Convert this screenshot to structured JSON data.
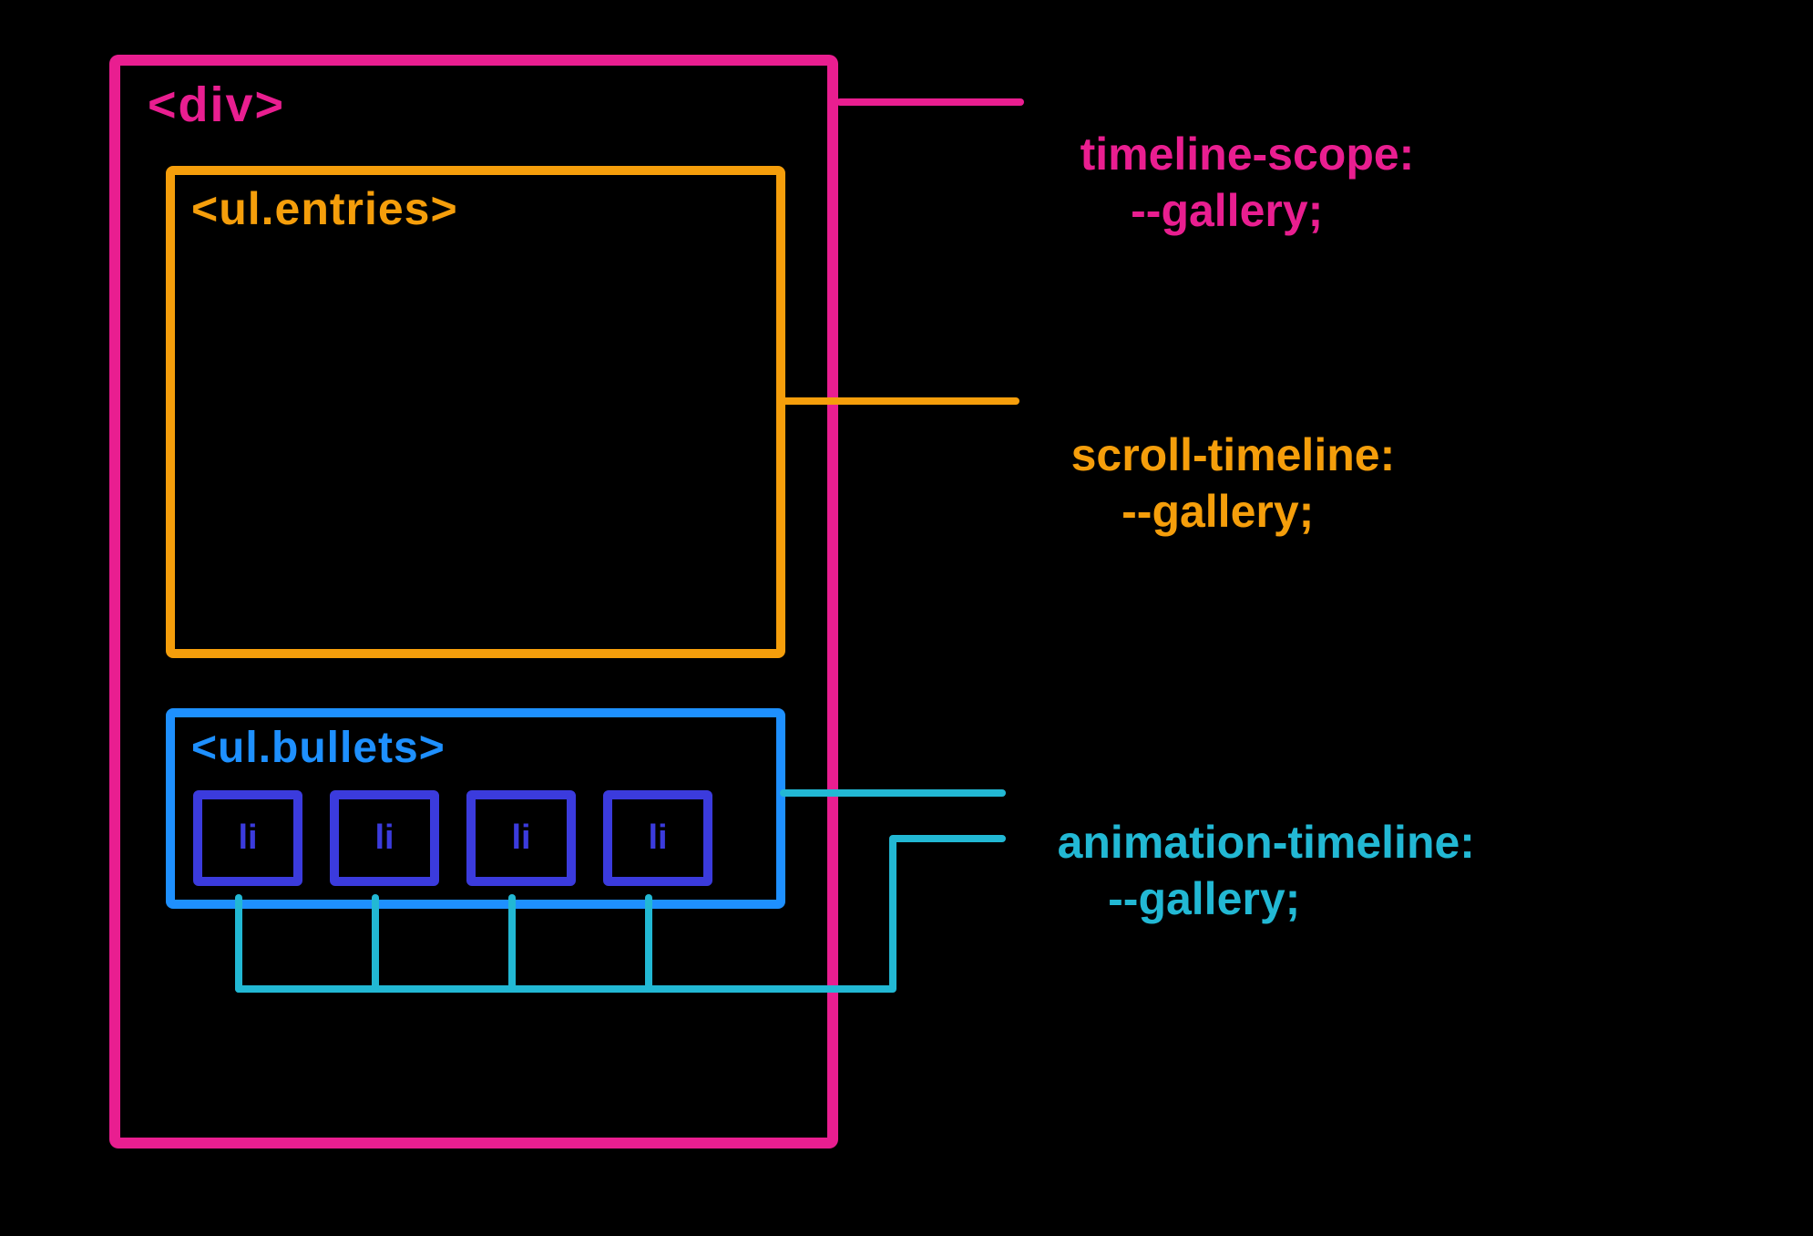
{
  "boxes": {
    "outer": {
      "label": "<div>",
      "color": "#E91E90"
    },
    "entries": {
      "label": "<ul.entries>",
      "color": "#F59E0B"
    },
    "bullets": {
      "label": "<ul.bullets>",
      "color": "#1E90FF",
      "items": [
        "li",
        "li",
        "li",
        "li"
      ],
      "item_color": "#3B3BDD"
    }
  },
  "annotations": {
    "timeline_scope": {
      "label": "timeline-scope:",
      "value": "--gallery;",
      "color": "#E91E90"
    },
    "scroll_timeline": {
      "label": "scroll-timeline:",
      "value": "--gallery;",
      "color": "#F59E0B"
    },
    "animation_timeline": {
      "label": "animation-timeline:",
      "value": "--gallery;",
      "color": "#22B8D4"
    }
  }
}
